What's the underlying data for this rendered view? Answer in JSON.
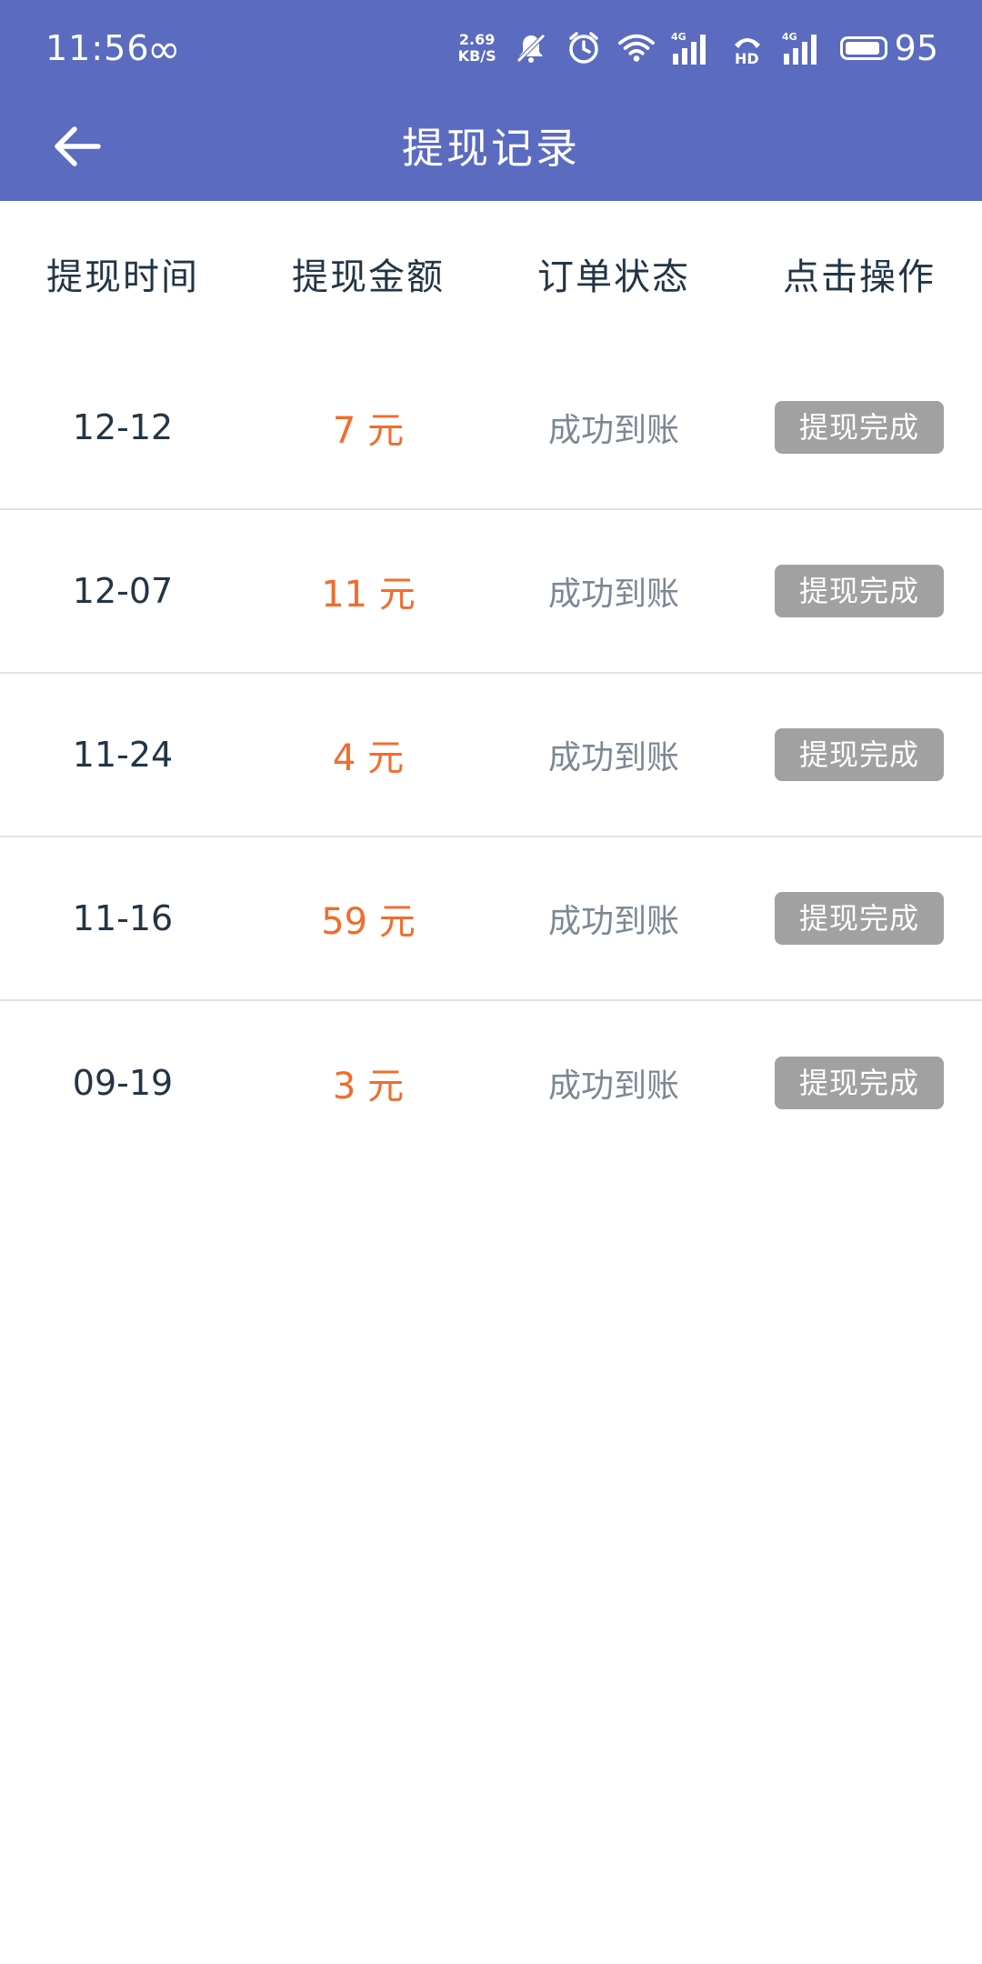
{
  "status_bar": {
    "time": "11:56",
    "loop_symbol": "∞",
    "net_speed_value": "2.69",
    "net_speed_unit": "KB/S",
    "network_4g_1": "4G",
    "hd_label": "HD",
    "network_4g_2": "4G",
    "battery_level": "95"
  },
  "app_bar": {
    "title": "提现记录"
  },
  "table": {
    "headers": [
      "提现时间",
      "提现金额",
      "订单状态",
      "点击操作"
    ],
    "rows": [
      {
        "date": "12-12",
        "amount": "7 元",
        "status": "成功到账",
        "action": "提现完成"
      },
      {
        "date": "12-07",
        "amount": "11 元",
        "status": "成功到账",
        "action": "提现完成"
      },
      {
        "date": "11-24",
        "amount": "4 元",
        "status": "成功到账",
        "action": "提现完成"
      },
      {
        "date": "11-16",
        "amount": "59 元",
        "status": "成功到账",
        "action": "提现完成"
      },
      {
        "date": "09-19",
        "amount": "3 元",
        "status": "成功到账",
        "action": "提现完成"
      }
    ]
  },
  "colors": {
    "header_bg": "#5B6BC0",
    "amount_text": "#F26C2B",
    "status_text": "#7b8894",
    "action_bg": "#a1a1a1",
    "divider": "#e1e1e1"
  }
}
